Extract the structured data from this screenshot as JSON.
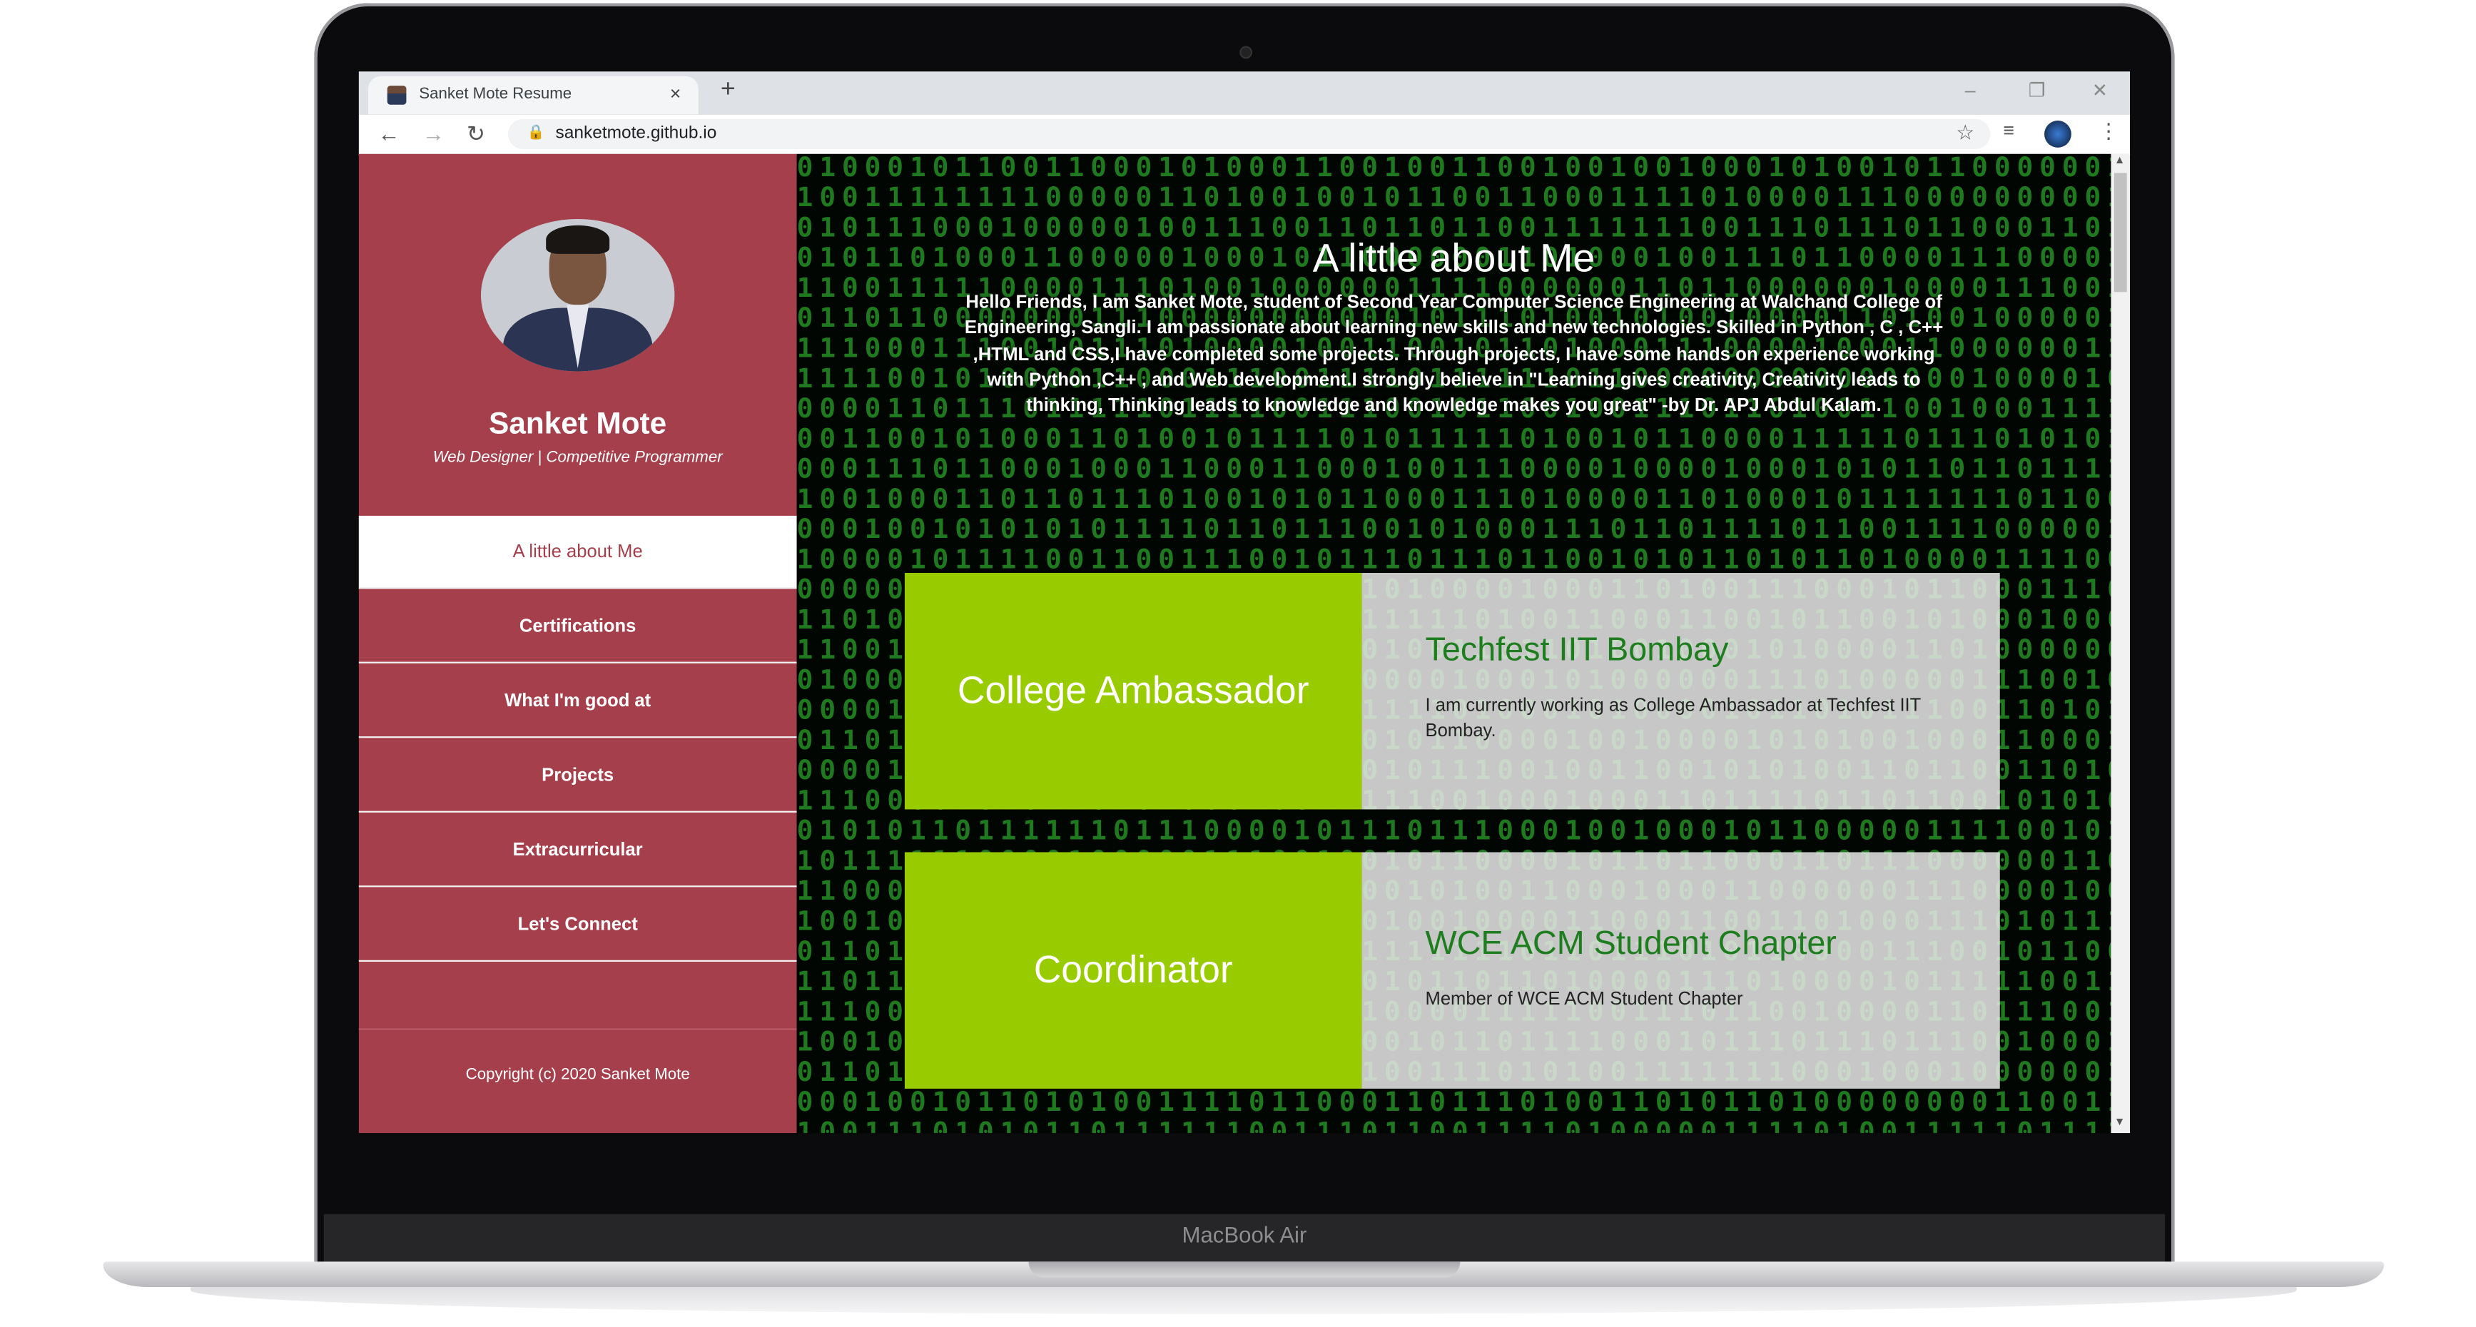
{
  "device": {
    "label": "MacBook Air"
  },
  "browser": {
    "tab_title": "Sanket Mote Resume",
    "tab_close": "×",
    "new_tab": "+",
    "url": "sanketmote.github.io",
    "window_controls": {
      "minimize": "–",
      "restore": "❐",
      "close": "✕"
    },
    "icons": {
      "back": "←",
      "forward": "→",
      "reload": "↻",
      "lock": "🔒",
      "star": "☆",
      "queue": "≡",
      "menu": "⋮"
    }
  },
  "sidebar": {
    "name": "Sanket Mote",
    "role": "Web Designer | Competitive Programmer",
    "nav": [
      {
        "label": "A little about Me",
        "active": true
      },
      {
        "label": "Certifications"
      },
      {
        "label": "What I'm good at"
      },
      {
        "label": "Projects"
      },
      {
        "label": "Extracurricular"
      },
      {
        "label": "Let's Connect"
      }
    ],
    "copyright": "Copyright (c) 2020 Sanket Mote",
    "color": "#a63f4c"
  },
  "main": {
    "title": "A little about Me",
    "paragraph": "Hello Friends, I am Sanket Mote, student of Second Year Computer Science Engineering at Walchand College of Engineering, Sangli. I am passionate about learning new skills and new technologies. Skilled in Python , C , C++ ,HTML and CSS,I have completed some projects. Through projects, I have some hands on experience working with Python ,C++ , and Web development.I strongly believe in \"Learning gives creativity, Creativity leads to thinking, Thinking leads to knowledge and knowledge makes you great\" -by Dr. APJ Abdul Kalam.",
    "cards": [
      {
        "role": "College Ambassador",
        "org": "Techfest IIT Bombay",
        "description": "I am currently working as College Ambassador at Techfest IIT Bombay."
      },
      {
        "role": "Coordinator",
        "org": "WCE ACM Student Chapter",
        "description": "Member of WCE ACM Student Chapter"
      }
    ],
    "accent": "#99cc00"
  }
}
